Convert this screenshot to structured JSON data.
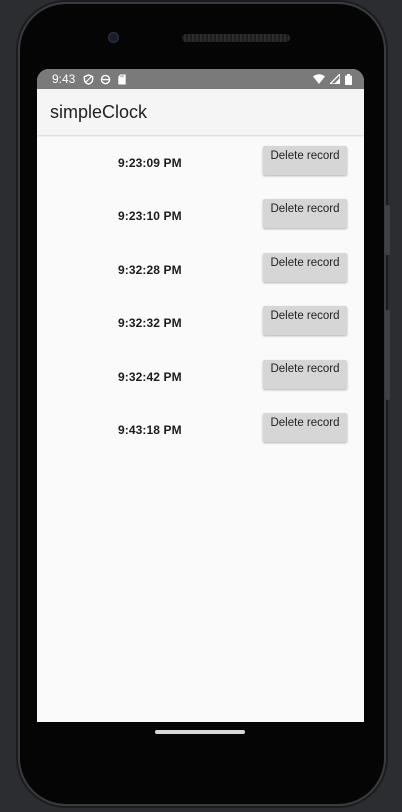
{
  "status_bar": {
    "time": "9:43",
    "icons_left": [
      "shield-icon",
      "sync-icon",
      "sd-card-icon"
    ],
    "icons_right": [
      "wifi-icon",
      "signal-icon",
      "battery-icon"
    ]
  },
  "app_bar": {
    "title": "simpleClock"
  },
  "records": [
    {
      "time": "9:23:09 PM",
      "button_label": "Delete record"
    },
    {
      "time": "9:23:10 PM",
      "button_label": "Delete record"
    },
    {
      "time": "9:32:28 PM",
      "button_label": "Delete record"
    },
    {
      "time": "9:32:32 PM",
      "button_label": "Delete record"
    },
    {
      "time": "9:32:42 PM",
      "button_label": "Delete record"
    },
    {
      "time": "9:43:18 PM",
      "button_label": "Delete record"
    }
  ],
  "colors": {
    "status_bar": "#7a7a7a",
    "app_bar": "#f5f5f5",
    "background": "#fafafa",
    "button": "#d6d6d6"
  }
}
